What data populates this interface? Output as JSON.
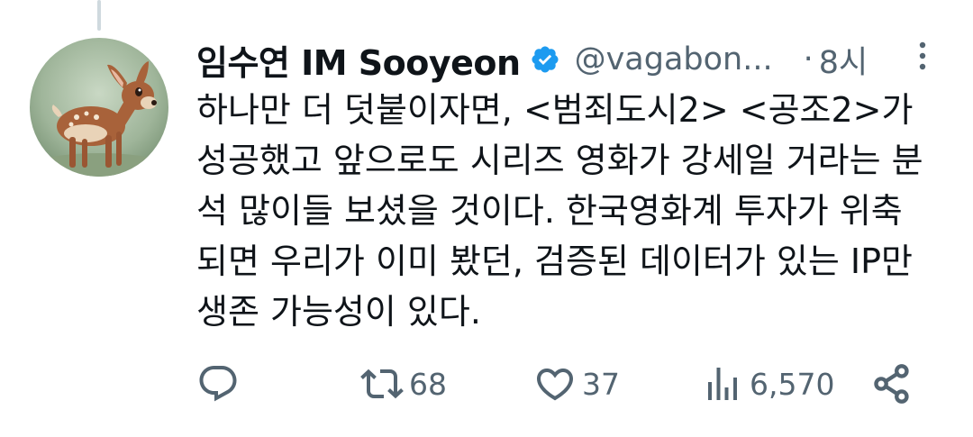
{
  "tweet": {
    "display_name": "임수연 IM Sooyeon",
    "handle": "@vagabon...",
    "separator": "·",
    "timestamp": "8시",
    "text_lines": [
      "하나만 더 덧붙이자면, <범죄도시2> <공조2>가",
      "성공했고 앞으로도 시리즈 영화가 강세일 거라는 분",
      "석 많이들 보셨을 것이다. 한국영화계 투자가 위축",
      "되면 우리가 이미 봤던, 검증된 데이터가 있는 IP만",
      "생존 가능성이 있다."
    ]
  },
  "actions": {
    "reply_count": "",
    "retweet_count": "68",
    "like_count": "37",
    "views_count": "6,570"
  },
  "colors": {
    "text_primary": "#0f1419",
    "text_secondary": "#536471",
    "verified_blue": "#1d9bf0",
    "thread_line": "#cfd9de"
  },
  "icons": {
    "verified": "verified-badge-icon",
    "more": "more-vertical-icon",
    "reply": "reply-icon",
    "retweet": "retweet-icon",
    "like": "heart-icon",
    "views": "views-bar-chart-icon",
    "share": "share-icon"
  }
}
